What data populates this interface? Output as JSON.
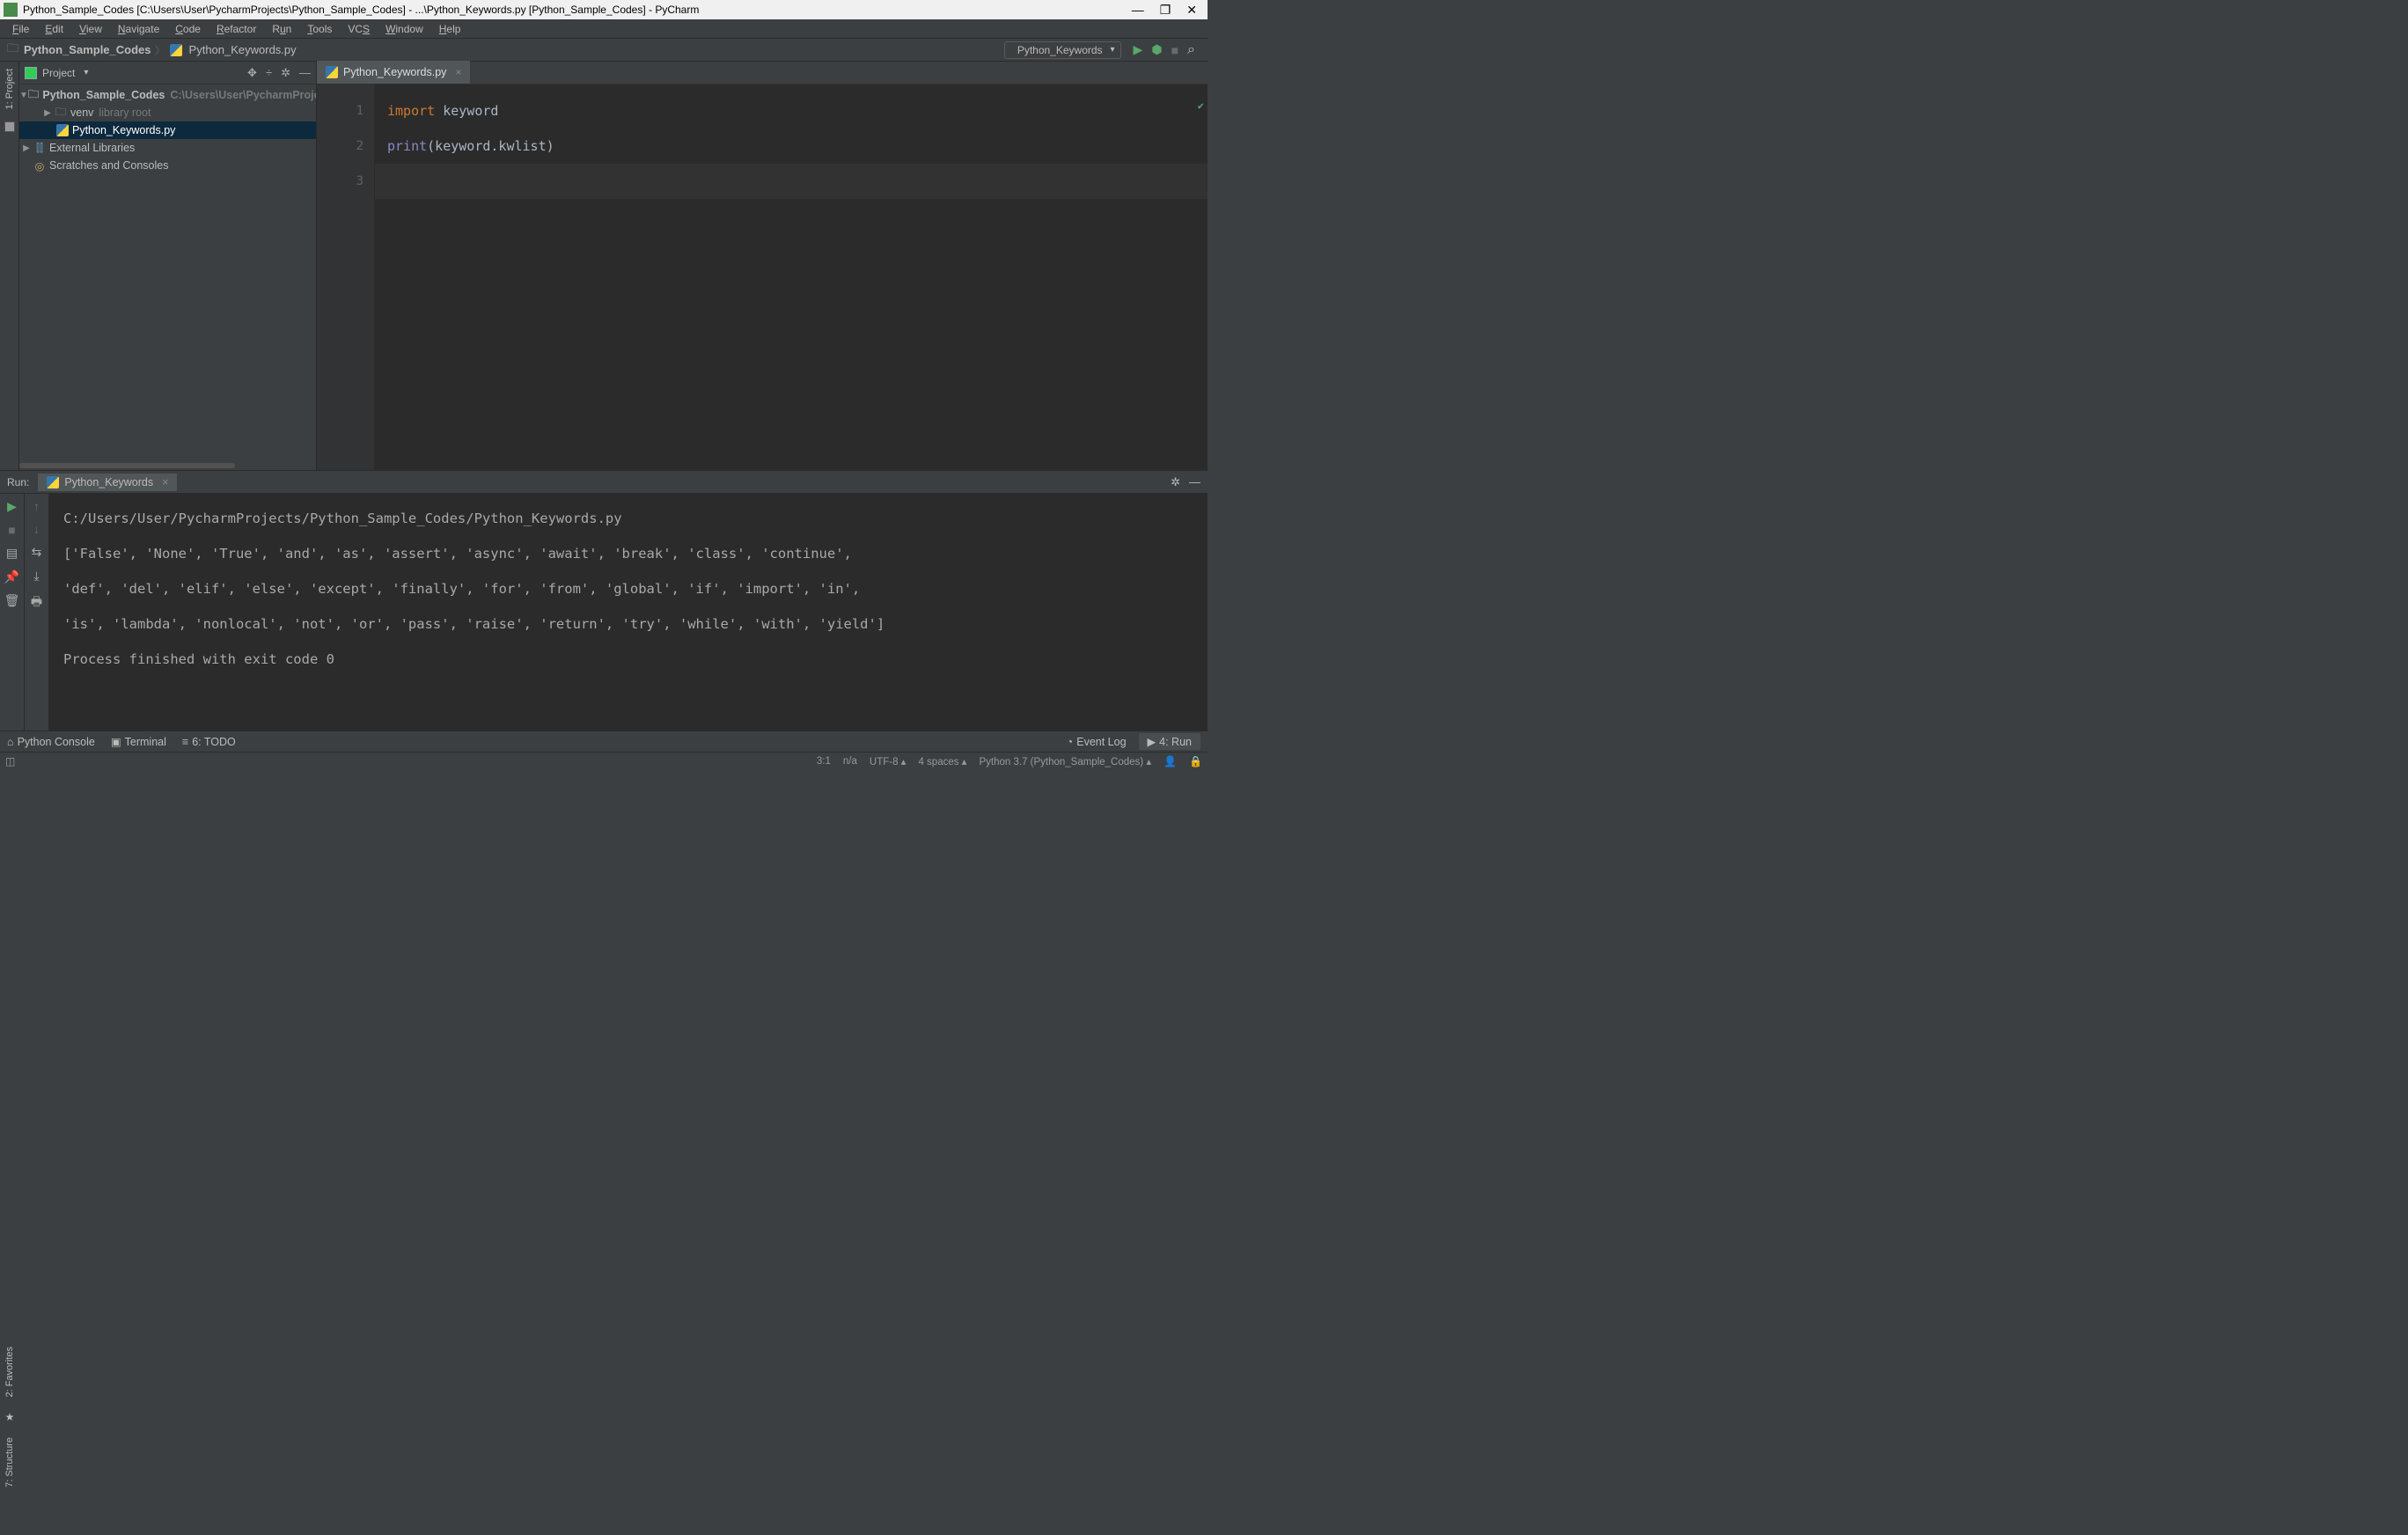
{
  "titlebar": {
    "text": "Python_Sample_Codes [C:\\Users\\User\\PycharmProjects\\Python_Sample_Codes] - ...\\Python_Keywords.py [Python_Sample_Codes] - PyCharm"
  },
  "menu": {
    "file": "File",
    "edit": "Edit",
    "view": "View",
    "navigate": "Navigate",
    "code": "Code",
    "refactor": "Refactor",
    "run": "Run",
    "tools": "Tools",
    "vcs": "VCS",
    "window": "Window",
    "help": "Help"
  },
  "breadcrumb": {
    "project": "Python_Sample_Codes",
    "file": "Python_Keywords.py"
  },
  "runConfig": {
    "name": "Python_Keywords"
  },
  "projectPanel": {
    "title": "Project"
  },
  "tree": {
    "project": "Python_Sample_Codes",
    "projectPath": "C:\\Users\\User\\PycharmProjects",
    "venv": "venv",
    "venvHint": "library root",
    "file": "Python_Keywords.py",
    "external": "External Libraries",
    "scratches": "Scratches and Consoles"
  },
  "editor": {
    "tab": "Python_Keywords.py",
    "line1_kw": "import",
    "line1_rest": " keyword",
    "line2_fn": "print",
    "line2_rest": "(keyword.kwlist)",
    "ln1": "1",
    "ln2": "2",
    "ln3": "3"
  },
  "run": {
    "label": "Run:",
    "tab": "Python_Keywords",
    "outputLine1": "    C:/Users/User/PycharmProjects/Python_Sample_Codes/Python_Keywords.py",
    "outputLine2": "['False', 'None', 'True', 'and', 'as', 'assert', 'async', 'await', 'break', 'class', 'continue',",
    "outputLine3": " 'def', 'del', 'elif', 'else', 'except', 'finally', 'for', 'from', 'global', 'if', 'import', 'in',",
    "outputLine4": " 'is', 'lambda', 'nonlocal', 'not', 'or', 'pass', 'raise', 'return', 'try', 'while', 'with', 'yield']",
    "outputLine5": "",
    "outputLine6": "Process finished with exit code 0"
  },
  "bottom": {
    "pythonConsole": "Python Console",
    "terminal": "Terminal",
    "todo": "6: TODO",
    "eventLog": "Event Log",
    "runBtn": "4: Run"
  },
  "status": {
    "pos": "3:1",
    "na": "n/a",
    "encoding": "UTF-8",
    "indent": "4 spaces",
    "interpreter": "Python 3.7 (Python_Sample_Codes)"
  },
  "leftRail": {
    "project": "1: Project",
    "favorites": "2: Favorites",
    "structure": "7: Structure"
  }
}
